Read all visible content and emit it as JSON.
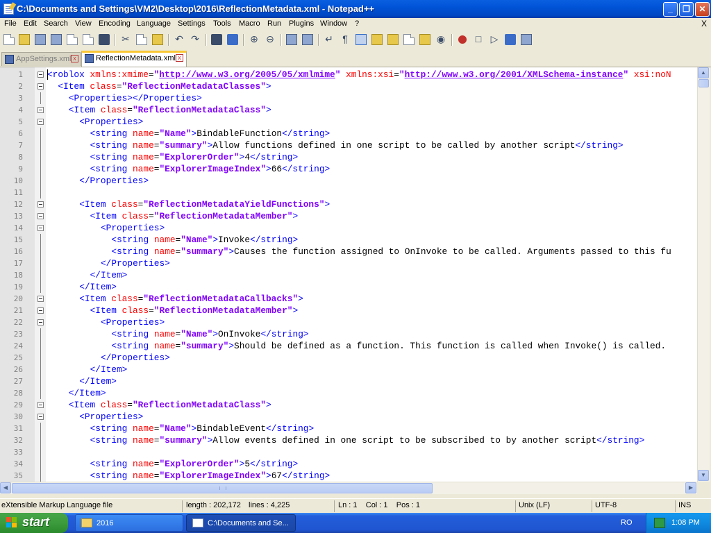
{
  "window": {
    "title": "C:\\Documents and Settings\\VM2\\Desktop\\2016\\ReflectionMetadata.xml - Notepad++",
    "controls": {
      "minimize": "_",
      "maximize": "❐",
      "close": "✕"
    }
  },
  "menu": [
    "File",
    "Edit",
    "Search",
    "View",
    "Encoding",
    "Language",
    "Settings",
    "Tools",
    "Macro",
    "Run",
    "Plugins",
    "Window",
    "?"
  ],
  "menu_close": "X",
  "tabs": [
    {
      "label": "AppSettings.xml",
      "active": false
    },
    {
      "label": "ReflectionMetadata.xml",
      "active": true
    }
  ],
  "editor": {
    "lines": [
      {
        "n": "1",
        "indent": 0,
        "fold": true,
        "tokens": [
          [
            "t",
            "<roblox "
          ],
          [
            "a",
            "xmlns:xmime"
          ],
          [
            "x",
            "="
          ],
          [
            "v",
            "\""
          ],
          [
            "u",
            "http://www.w3.org/2005/05/xmlmime"
          ],
          [
            "v",
            "\""
          ],
          [
            "x",
            " "
          ],
          [
            "a",
            "xmlns:xsi"
          ],
          [
            "x",
            "="
          ],
          [
            "v",
            "\""
          ],
          [
            "u",
            "http://www.w3.org/2001/XMLSchema-instance"
          ],
          [
            "v",
            "\""
          ],
          [
            "x",
            " "
          ],
          [
            "a",
            "xsi:noN"
          ]
        ]
      },
      {
        "n": "2",
        "indent": 2,
        "fold": true,
        "tokens": [
          [
            "t",
            "<Item "
          ],
          [
            "a",
            "class"
          ],
          [
            "x",
            "="
          ],
          [
            "v",
            "\"ReflectionMetadataClasses\""
          ],
          [
            "t",
            ">"
          ]
        ]
      },
      {
        "n": "3",
        "indent": 4,
        "fold": false,
        "tokens": [
          [
            "t",
            "<Properties></Properties>"
          ]
        ]
      },
      {
        "n": "4",
        "indent": 4,
        "fold": true,
        "tokens": [
          [
            "t",
            "<Item "
          ],
          [
            "a",
            "class"
          ],
          [
            "x",
            "="
          ],
          [
            "v",
            "\"ReflectionMetadataClass\""
          ],
          [
            "t",
            ">"
          ]
        ]
      },
      {
        "n": "5",
        "indent": 6,
        "fold": true,
        "tokens": [
          [
            "t",
            "<Properties>"
          ]
        ]
      },
      {
        "n": "6",
        "indent": 8,
        "fold": false,
        "tokens": [
          [
            "t",
            "<string "
          ],
          [
            "a",
            "name"
          ],
          [
            "x",
            "="
          ],
          [
            "v",
            "\"Name\""
          ],
          [
            "t",
            ">"
          ],
          [
            "x",
            "BindableFunction"
          ],
          [
            "t",
            "</string>"
          ]
        ]
      },
      {
        "n": "7",
        "indent": 8,
        "fold": false,
        "tokens": [
          [
            "t",
            "<string "
          ],
          [
            "a",
            "name"
          ],
          [
            "x",
            "="
          ],
          [
            "v",
            "\"summary\""
          ],
          [
            "t",
            ">"
          ],
          [
            "x",
            "Allow functions defined in one script to be called by another script"
          ],
          [
            "t",
            "</string>"
          ]
        ]
      },
      {
        "n": "8",
        "indent": 8,
        "fold": false,
        "tokens": [
          [
            "t",
            "<string "
          ],
          [
            "a",
            "name"
          ],
          [
            "x",
            "="
          ],
          [
            "v",
            "\"ExplorerOrder\""
          ],
          [
            "t",
            ">"
          ],
          [
            "x",
            "4"
          ],
          [
            "t",
            "</string>"
          ]
        ]
      },
      {
        "n": "9",
        "indent": 8,
        "fold": false,
        "tokens": [
          [
            "t",
            "<string "
          ],
          [
            "a",
            "name"
          ],
          [
            "x",
            "="
          ],
          [
            "v",
            "\"ExplorerImageIndex\""
          ],
          [
            "t",
            ">"
          ],
          [
            "x",
            "66"
          ],
          [
            "t",
            "</string>"
          ]
        ]
      },
      {
        "n": "10",
        "indent": 6,
        "fold": false,
        "tokens": [
          [
            "t",
            "</Properties>"
          ]
        ]
      },
      {
        "n": "11",
        "indent": 0,
        "fold": false,
        "tokens": []
      },
      {
        "n": "12",
        "indent": 6,
        "fold": true,
        "tokens": [
          [
            "t",
            "<Item "
          ],
          [
            "a",
            "class"
          ],
          [
            "x",
            "="
          ],
          [
            "v",
            "\"ReflectionMetadataYieldFunctions\""
          ],
          [
            "t",
            ">"
          ]
        ]
      },
      {
        "n": "13",
        "indent": 8,
        "fold": true,
        "tokens": [
          [
            "t",
            "<Item "
          ],
          [
            "a",
            "class"
          ],
          [
            "x",
            "="
          ],
          [
            "v",
            "\"ReflectionMetadataMember\""
          ],
          [
            "t",
            ">"
          ]
        ]
      },
      {
        "n": "14",
        "indent": 10,
        "fold": true,
        "tokens": [
          [
            "t",
            "<Properties>"
          ]
        ]
      },
      {
        "n": "15",
        "indent": 12,
        "fold": false,
        "tokens": [
          [
            "t",
            "<string "
          ],
          [
            "a",
            "name"
          ],
          [
            "x",
            "="
          ],
          [
            "v",
            "\"Name\""
          ],
          [
            "t",
            ">"
          ],
          [
            "x",
            "Invoke"
          ],
          [
            "t",
            "</string>"
          ]
        ]
      },
      {
        "n": "16",
        "indent": 12,
        "fold": false,
        "tokens": [
          [
            "t",
            "<string "
          ],
          [
            "a",
            "name"
          ],
          [
            "x",
            "="
          ],
          [
            "v",
            "\"summary\""
          ],
          [
            "t",
            ">"
          ],
          [
            "x",
            "Causes the function assigned to OnInvoke to be called. Arguments passed to this fu"
          ]
        ]
      },
      {
        "n": "17",
        "indent": 10,
        "fold": false,
        "tokens": [
          [
            "t",
            "</Properties>"
          ]
        ]
      },
      {
        "n": "18",
        "indent": 8,
        "fold": false,
        "tokens": [
          [
            "t",
            "</Item>"
          ]
        ]
      },
      {
        "n": "19",
        "indent": 6,
        "fold": false,
        "tokens": [
          [
            "t",
            "</Item>"
          ]
        ]
      },
      {
        "n": "20",
        "indent": 6,
        "fold": true,
        "tokens": [
          [
            "t",
            "<Item "
          ],
          [
            "a",
            "class"
          ],
          [
            "x",
            "="
          ],
          [
            "v",
            "\"ReflectionMetadataCallbacks\""
          ],
          [
            "t",
            ">"
          ]
        ]
      },
      {
        "n": "21",
        "indent": 8,
        "fold": true,
        "tokens": [
          [
            "t",
            "<Item "
          ],
          [
            "a",
            "class"
          ],
          [
            "x",
            "="
          ],
          [
            "v",
            "\"ReflectionMetadataMember\""
          ],
          [
            "t",
            ">"
          ]
        ]
      },
      {
        "n": "22",
        "indent": 10,
        "fold": true,
        "tokens": [
          [
            "t",
            "<Properties>"
          ]
        ]
      },
      {
        "n": "23",
        "indent": 12,
        "fold": false,
        "tokens": [
          [
            "t",
            "<string "
          ],
          [
            "a",
            "name"
          ],
          [
            "x",
            "="
          ],
          [
            "v",
            "\"Name\""
          ],
          [
            "t",
            ">"
          ],
          [
            "x",
            "OnInvoke"
          ],
          [
            "t",
            "</string>"
          ]
        ]
      },
      {
        "n": "24",
        "indent": 12,
        "fold": false,
        "tokens": [
          [
            "t",
            "<string "
          ],
          [
            "a",
            "name"
          ],
          [
            "x",
            "="
          ],
          [
            "v",
            "\"summary\""
          ],
          [
            "t",
            ">"
          ],
          [
            "x",
            "Should be defined as a function. This function is called when Invoke() is called."
          ]
        ]
      },
      {
        "n": "25",
        "indent": 10,
        "fold": false,
        "tokens": [
          [
            "t",
            "</Properties>"
          ]
        ]
      },
      {
        "n": "26",
        "indent": 8,
        "fold": false,
        "tokens": [
          [
            "t",
            "</Item>"
          ]
        ]
      },
      {
        "n": "27",
        "indent": 6,
        "fold": false,
        "tokens": [
          [
            "t",
            "</Item>"
          ]
        ]
      },
      {
        "n": "28",
        "indent": 4,
        "fold": false,
        "tokens": [
          [
            "t",
            "</Item>"
          ]
        ]
      },
      {
        "n": "29",
        "indent": 4,
        "fold": true,
        "tokens": [
          [
            "t",
            "<Item "
          ],
          [
            "a",
            "class"
          ],
          [
            "x",
            "="
          ],
          [
            "v",
            "\"ReflectionMetadataClass\""
          ],
          [
            "t",
            ">"
          ]
        ]
      },
      {
        "n": "30",
        "indent": 6,
        "fold": true,
        "tokens": [
          [
            "t",
            "<Properties>"
          ]
        ]
      },
      {
        "n": "31",
        "indent": 8,
        "fold": false,
        "tokens": [
          [
            "t",
            "<string "
          ],
          [
            "a",
            "name"
          ],
          [
            "x",
            "="
          ],
          [
            "v",
            "\"Name\""
          ],
          [
            "t",
            ">"
          ],
          [
            "x",
            "BindableEvent"
          ],
          [
            "t",
            "</string>"
          ]
        ]
      },
      {
        "n": "32",
        "indent": 8,
        "fold": false,
        "tokens": [
          [
            "t",
            "<string "
          ],
          [
            "a",
            "name"
          ],
          [
            "x",
            "="
          ],
          [
            "v",
            "\"summary\""
          ],
          [
            "t",
            ">"
          ],
          [
            "x",
            "Allow events defined in one script to be subscribed to by another script"
          ],
          [
            "t",
            "</string>"
          ]
        ]
      },
      {
        "n": "33",
        "indent": 0,
        "fold": false,
        "tokens": []
      },
      {
        "n": "34",
        "indent": 8,
        "fold": false,
        "tokens": [
          [
            "t",
            "<string "
          ],
          [
            "a",
            "name"
          ],
          [
            "x",
            "="
          ],
          [
            "v",
            "\"ExplorerOrder\""
          ],
          [
            "t",
            ">"
          ],
          [
            "x",
            "5"
          ],
          [
            "t",
            "</string>"
          ]
        ]
      },
      {
        "n": "35",
        "indent": 8,
        "fold": false,
        "tokens": [
          [
            "t",
            "<string "
          ],
          [
            "a",
            "name"
          ],
          [
            "x",
            "="
          ],
          [
            "v",
            "\"ExplorerImageIndex\""
          ],
          [
            "t",
            ">"
          ],
          [
            "x",
            "67"
          ],
          [
            "t",
            "</string>"
          ]
        ]
      }
    ]
  },
  "status": {
    "filetype": "eXtensible Markup Language file",
    "length": "length : 202,172",
    "lines": "lines : 4,225",
    "position": "Ln : 1    Col : 1    Pos : 1",
    "eol": "Unix (LF)",
    "encoding": "UTF-8",
    "mode": "INS"
  },
  "taskbar": {
    "start": "start",
    "tasks": [
      {
        "label": "2016",
        "active": false
      },
      {
        "label": "C:\\Documents and Se...",
        "active": true
      }
    ],
    "lang": "RO",
    "clock": "1:08 PM"
  },
  "colors": {
    "tag": "#0000ff",
    "attr": "#ff0000",
    "value": "#8000ff",
    "text": "#000000",
    "title_bar": "#0053d6",
    "start_green": "#3c9b3c"
  }
}
